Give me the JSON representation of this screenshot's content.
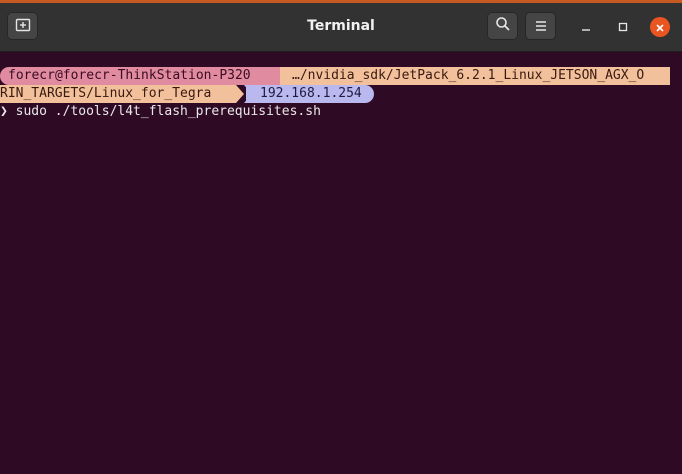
{
  "window": {
    "title": "Terminal"
  },
  "titlebar": {
    "new_tab_icon": "new-tab-icon",
    "search_icon": "search-icon",
    "menu_icon": "hamburger-menu-icon",
    "minimize_icon": "minimize-icon",
    "maximize_icon": "maximize-icon",
    "close_icon": "close-icon"
  },
  "prompt": {
    "user_host": "forecr@forecr-ThinkStation-P320",
    "path_line1": "…/nvidia_sdk/JetPack_6.2.1_Linux_JETSON_AGX_O",
    "path_line2": "RIN_TARGETS/Linux_for_Tegra",
    "ip": "192.168.1.254",
    "prompt_char": "❯",
    "command": "sudo ./tools/l4t_flash_prerequisites.sh"
  },
  "colors": {
    "accent": "#e95420",
    "terminal_bg": "#2f0a24",
    "user_segment": "#e18ba1",
    "path_segment": "#f2c19c",
    "ip_segment": "#b9b9f0"
  }
}
